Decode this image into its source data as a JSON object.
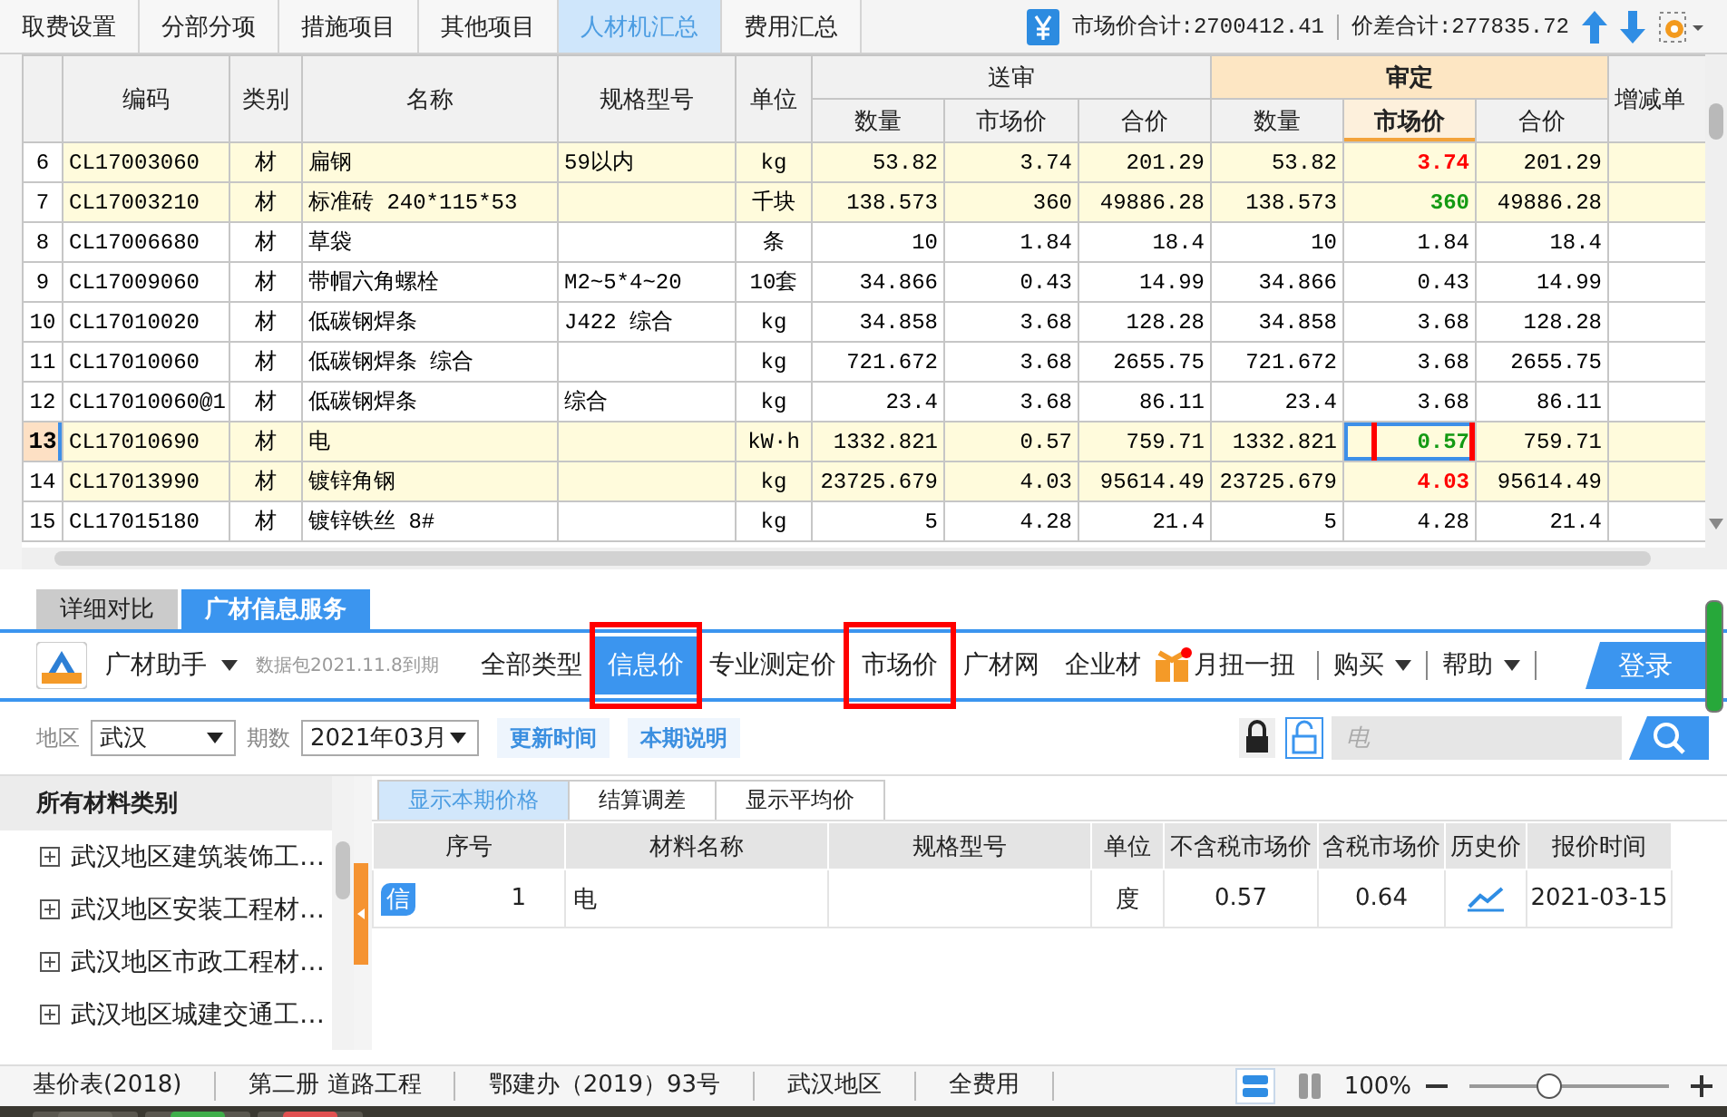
{
  "top_tabs": [
    {
      "label": "取费设置",
      "selected": false
    },
    {
      "label": "分部分项",
      "selected": false
    },
    {
      "label": "措施项目",
      "selected": false
    },
    {
      "label": "其他项目",
      "selected": false
    },
    {
      "label": "人材机汇总",
      "selected": true
    },
    {
      "label": "费用汇总",
      "selected": false
    }
  ],
  "totals": {
    "market_total": "市场价合计:2700412.41",
    "difference_total": "价差合计:277835.72"
  },
  "grid": {
    "columns": [
      "编码",
      "类别",
      "名称",
      "规格型号",
      "单位"
    ],
    "groups": [
      {
        "label": "送审",
        "selected": false,
        "columns": [
          {
            "label": "数量",
            "selected": false
          },
          {
            "label": "市场价",
            "selected": false
          },
          {
            "label": "合价",
            "selected": false
          }
        ]
      },
      {
        "label": "审定",
        "selected": true,
        "columns": [
          {
            "label": "数量",
            "selected": false
          },
          {
            "label": "市场价",
            "selected": true
          },
          {
            "label": "合价",
            "selected": false
          }
        ]
      }
    ],
    "last_column": "增减单",
    "rows": [
      {
        "no": "6",
        "code": "CL17003060",
        "type": "材",
        "name": "扁钢",
        "spec": "59以内",
        "unit": "kg",
        "submitted_qty": "53.82",
        "submitted_price": "3.74",
        "submitted_total": "201.29",
        "audited_qty": "53.82",
        "audited_price": {
          "value": "3.74",
          "color": "#ff0000"
        },
        "audited_total": "201.29",
        "highlighted": true,
        "selected": false,
        "annotated": false
      },
      {
        "no": "7",
        "code": "CL17003210",
        "type": "材",
        "name": "标准砖 240*115*53",
        "unit": "千块",
        "submitted_qty": "138.573",
        "submitted_price": "360",
        "submitted_total": "49886.28",
        "audited_qty": "138.573",
        "audited_price": {
          "value": "360",
          "color": "#139a13"
        },
        "audited_total": "49886.28",
        "highlighted": true,
        "selected": false,
        "annotated": false
      },
      {
        "no": "8",
        "code": "CL17006680",
        "type": "材",
        "name": "草袋",
        "unit": "条",
        "submitted_qty": "10",
        "submitted_price": "1.84",
        "submitted_total": "18.4",
        "audited_qty": "10",
        "audited_price": {
          "value": "1.84"
        },
        "audited_total": "18.4",
        "highlighted": false,
        "selected": false,
        "annotated": false
      },
      {
        "no": "9",
        "code": "CL17009060",
        "type": "材",
        "name": "带帽六角螺栓",
        "spec": "M2~5*4~20",
        "unit": "10套",
        "submitted_qty": "34.866",
        "submitted_price": "0.43",
        "submitted_total": "14.99",
        "audited_qty": "34.866",
        "audited_price": {
          "value": "0.43"
        },
        "audited_total": "14.99",
        "highlighted": false,
        "selected": false,
        "annotated": false
      },
      {
        "no": "10",
        "code": "CL17010020",
        "type": "材",
        "name": "低碳钢焊条",
        "spec": "J422 综合",
        "unit": "kg",
        "submitted_qty": "34.858",
        "submitted_price": "3.68",
        "submitted_total": "128.28",
        "audited_qty": "34.858",
        "audited_price": {
          "value": "3.68"
        },
        "audited_total": "128.28",
        "highlighted": false,
        "selected": false,
        "annotated": false
      },
      {
        "no": "11",
        "code": "CL17010060",
        "type": "材",
        "name": "低碳钢焊条 综合",
        "unit": "kg",
        "submitted_qty": "721.672",
        "submitted_price": "3.68",
        "submitted_total": "2655.75",
        "audited_qty": "721.672",
        "audited_price": {
          "value": "3.68"
        },
        "audited_total": "2655.75",
        "highlighted": false,
        "selected": false,
        "annotated": false
      },
      {
        "no": "12",
        "code": "CL17010060@1",
        "type": "材",
        "name": "低碳钢焊条",
        "spec": "综合",
        "unit": "kg",
        "submitted_qty": "23.4",
        "submitted_price": "3.68",
        "submitted_total": "86.11",
        "audited_qty": "23.4",
        "audited_price": {
          "value": "3.68"
        },
        "audited_total": "86.11",
        "highlighted": false,
        "selected": false,
        "annotated": false
      },
      {
        "no": "13",
        "code": "CL17010690",
        "type": "材",
        "name": "电",
        "unit": "kW·h",
        "submitted_qty": "1332.821",
        "submitted_price": "0.57",
        "submitted_total": "759.71",
        "audited_qty": "1332.821",
        "audited_price": {
          "value": "0.57",
          "color": "#139a13"
        },
        "audited_total": "759.71",
        "highlighted": true,
        "selected": true,
        "annotated": true
      },
      {
        "no": "14",
        "code": "CL17013990",
        "type": "材",
        "name": "镀锌角钢",
        "unit": "kg",
        "submitted_qty": "23725.679",
        "submitted_price": "4.03",
        "submitted_total": "95614.49",
        "audited_qty": "23725.679",
        "audited_price": {
          "value": "4.03",
          "color": "#ff0000"
        },
        "audited_total": "95614.49",
        "highlighted": true,
        "selected": false,
        "annotated": false
      },
      {
        "no": "15",
        "code": "CL17015180",
        "type": "材",
        "name": "镀锌铁丝 8#",
        "unit": "kg",
        "submitted_qty": "5",
        "submitted_price": "4.28",
        "submitted_total": "21.4",
        "audited_qty": "5",
        "audited_price": {
          "value": "4.28"
        },
        "audited_total": "21.4",
        "highlighted": false,
        "selected": false,
        "annotated": false
      }
    ]
  },
  "panel": {
    "tabs": [
      {
        "label": "详细对比",
        "selected": false
      },
      {
        "label": "广材信息服务",
        "selected": true
      }
    ],
    "toolbar": {
      "brand": "广材助手",
      "expiry": "数据包2021.11.8到期",
      "nav": [
        {
          "label": "全部类型",
          "selected": false,
          "annotated": false
        },
        {
          "label": "信息价",
          "selected": true,
          "annotated": true
        },
        {
          "label": "专业测定价",
          "selected": false,
          "annotated": false
        },
        {
          "label": "市场价",
          "selected": false,
          "annotated": true
        },
        {
          "label": "广材网",
          "selected": false,
          "annotated": false
        },
        {
          "label": "企业材",
          "selected": false,
          "annotated": false
        }
      ],
      "promo": "月扭一扭",
      "menus": [
        "购买",
        "帮助"
      ],
      "login": "登录"
    },
    "filters": {
      "region_label": "地区",
      "region": "武汉",
      "period_label": "期数",
      "period": "2021年03月",
      "buttons": [
        "更新时间",
        "本期说明"
      ],
      "search": {
        "placeholder": "电"
      }
    },
    "categories": {
      "title": "所有材料类别",
      "items": [
        {
          "label": "武汉地区建筑装饰工…",
          "expanded": false
        },
        {
          "label": "武汉地区安装工程材…",
          "expanded": false
        },
        {
          "label": "武汉地区市政工程材…",
          "expanded": false
        },
        {
          "label": "武汉地区城建交通工…",
          "expanded": false
        }
      ]
    },
    "price_tabs": [
      {
        "label": "显示本期价格",
        "selected": true
      },
      {
        "label": "结算调差",
        "selected": false
      },
      {
        "label": "显示平均价",
        "selected": false
      }
    ],
    "price_table": {
      "columns": [
        "序号",
        "材料名称",
        "规格型号",
        "单位",
        "不含税市场价",
        "含税市场价",
        "历史价",
        "报价时间"
      ],
      "rows": [
        {
          "badge": "信",
          "no": "1",
          "name": "电",
          "unit": "度",
          "price_excl_tax": "0.57",
          "price_incl_tax": "0.64",
          "quote_date": "2021-03-15"
        }
      ]
    }
  },
  "status_bar": {
    "items": [
      "基价表(2018)",
      "第二册 道路工程",
      "鄂建办（2019）93号",
      "武汉地区",
      "全费用"
    ],
    "view_modes": [
      {
        "kind": "rows",
        "selected": true
      },
      {
        "kind": "columns",
        "selected": false
      }
    ],
    "zoom": {
      "reading": "100%",
      "level": 0.4
    }
  }
}
